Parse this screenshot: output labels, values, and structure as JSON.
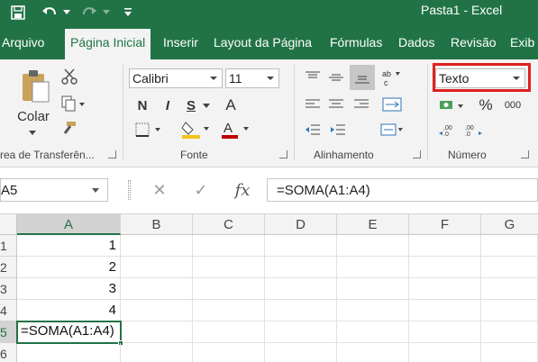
{
  "titlebar": {
    "title": "Pasta1  -  Excel",
    "qat": {
      "save_icon": "save-icon",
      "undo_icon": "undo-icon",
      "redo_icon": "redo-icon",
      "customize_icon": "customize-qat-icon"
    }
  },
  "tabs": [
    {
      "label": "Arquivo"
    },
    {
      "label": "Página Inicial",
      "active": true
    },
    {
      "label": "Inserir"
    },
    {
      "label": "Layout da Página"
    },
    {
      "label": "Fórmulas"
    },
    {
      "label": "Dados"
    },
    {
      "label": "Revisão"
    },
    {
      "label": "Exib"
    }
  ],
  "ribbon": {
    "clipboard": {
      "paste_label": "Colar",
      "group_label": "rea de Transferên..."
    },
    "font": {
      "name": "Calibri",
      "size": "11",
      "bold": "N",
      "italic": "I",
      "underline": "S",
      "grow": "A",
      "group_label": "Fonte"
    },
    "alignment": {
      "group_label": "Alinhamento"
    },
    "number": {
      "format": "Texto",
      "percent": "%",
      "thousands": "000",
      "group_label": "Número"
    },
    "colors": {
      "accent": "#217346",
      "highlight_box": "#e02020",
      "fill_color": "#f0c419",
      "font_color": "#c00000"
    }
  },
  "formula_bar": {
    "name_box": "A5",
    "cancel": "✕",
    "enter": "✓",
    "fx": "fx",
    "formula": "=SOMA(A1:A4)"
  },
  "sheet": {
    "columns": [
      "A",
      "B",
      "C",
      "D",
      "E",
      "F",
      "G"
    ],
    "rows": [
      "1",
      "2",
      "3",
      "4",
      "5",
      "6"
    ],
    "cells": {
      "A1": "1",
      "A2": "2",
      "A3": "3",
      "A4": "4",
      "A5": "=SOMA(A1:A4)"
    },
    "active_cell": "A5"
  }
}
